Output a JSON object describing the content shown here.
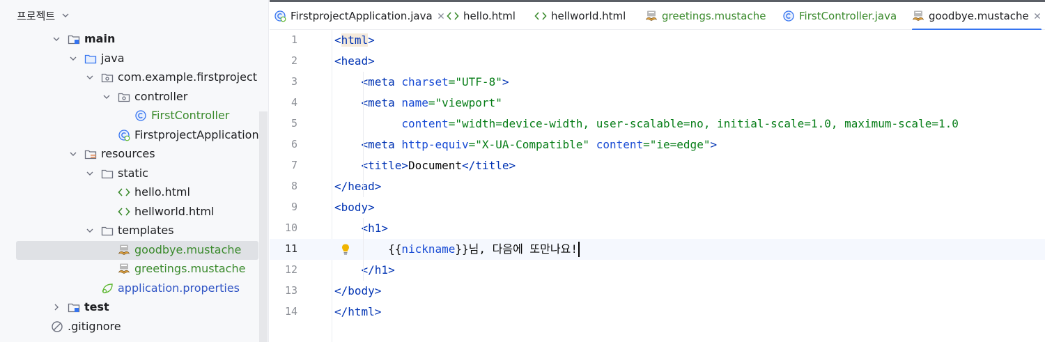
{
  "project_panel": {
    "title": "프로젝트",
    "tree": [
      {
        "name": "tree-row-main",
        "label": "main",
        "bold": true,
        "arrow": "expanded",
        "icon": "module-folder-icon",
        "color": "dark"
      },
      {
        "name": "tree-row-java",
        "label": "java",
        "bold": false,
        "arrow": "expanded",
        "icon": "source-folder-icon",
        "color": "dark"
      },
      {
        "name": "tree-row-package",
        "label": "com.example.firstproject",
        "bold": false,
        "arrow": "expanded",
        "icon": "package-icon",
        "color": "dark"
      },
      {
        "name": "tree-row-controller",
        "label": "controller",
        "bold": false,
        "arrow": "expanded",
        "icon": "package-icon",
        "color": "dark"
      },
      {
        "name": "tree-row-firstcontroller",
        "label": "FirstController",
        "bold": false,
        "arrow": "none",
        "icon": "java-class-icon",
        "color": "green"
      },
      {
        "name": "tree-row-firstprojectapplication",
        "label": "FirstprojectApplication",
        "bold": false,
        "arrow": "none",
        "icon": "spring-boot-class-icon",
        "color": "dark"
      },
      {
        "name": "tree-row-resources",
        "label": "resources",
        "bold": false,
        "arrow": "expanded",
        "icon": "resources-folder-icon",
        "color": "dark"
      },
      {
        "name": "tree-row-static",
        "label": "static",
        "bold": false,
        "arrow": "expanded",
        "icon": "folder-icon",
        "color": "dark"
      },
      {
        "name": "tree-row-hello-html",
        "label": "hello.html",
        "bold": false,
        "arrow": "none",
        "icon": "html-file-icon",
        "color": "dark"
      },
      {
        "name": "tree-row-hellworld-html",
        "label": "hellworld.html",
        "bold": false,
        "arrow": "none",
        "icon": "html-file-icon",
        "color": "dark"
      },
      {
        "name": "tree-row-templates",
        "label": "templates",
        "bold": false,
        "arrow": "expanded",
        "icon": "folder-icon",
        "color": "dark"
      },
      {
        "name": "tree-row-goodbye-mustache",
        "label": "goodbye.mustache",
        "bold": false,
        "arrow": "none",
        "icon": "mustache-file-icon",
        "color": "green",
        "selected": true
      },
      {
        "name": "tree-row-greetings-mustache",
        "label": "greetings.mustache",
        "bold": false,
        "arrow": "none",
        "icon": "mustache-file-icon",
        "color": "green"
      },
      {
        "name": "tree-row-application-properties",
        "label": "application.properties",
        "bold": false,
        "arrow": "none",
        "icon": "spring-properties-icon",
        "color": "blue"
      },
      {
        "name": "tree-row-test",
        "label": "test",
        "bold": true,
        "arrow": "collapsed",
        "icon": "module-folder-icon",
        "color": "dark"
      },
      {
        "name": "tree-row-gitignore",
        "label": ".gitignore",
        "bold": false,
        "arrow": "none",
        "icon": "ignore-file-icon",
        "color": "dark"
      }
    ]
  },
  "tabs": [
    {
      "name": "tab-firstprojectapplication",
      "label": "FirstprojectApplication.java",
      "icon": "spring-boot-class-icon",
      "color": "dark",
      "closable": true
    },
    {
      "name": "tab-hello-html",
      "label": "hello.html",
      "icon": "html-file-icon",
      "color": "dark"
    },
    {
      "name": "tab-hellworld-html",
      "label": "hellworld.html",
      "icon": "html-file-icon",
      "color": "dark"
    },
    {
      "name": "tab-greetings-mustache",
      "label": "greetings.mustache",
      "icon": "mustache-file-icon",
      "color": "green"
    },
    {
      "name": "tab-firstcontroller-java",
      "label": "FirstController.java",
      "icon": "java-class-icon",
      "color": "green"
    },
    {
      "name": "tab-goodbye-mustache",
      "label": "goodbye.mustache",
      "icon": "mustache-file-icon",
      "color": "dark",
      "closable": true,
      "active": true
    }
  ],
  "editor": {
    "current_line": 11,
    "lines": [
      {
        "n": "1",
        "tokens": [
          [
            "t",
            "<"
          ],
          [
            "th",
            "html"
          ],
          [
            "t",
            ">"
          ]
        ]
      },
      {
        "n": "2",
        "tokens": [
          [
            "t",
            "<head>"
          ]
        ]
      },
      {
        "n": "3",
        "tokens": [
          [
            "x",
            "    "
          ],
          [
            "t",
            "<meta "
          ],
          [
            "a",
            "charset"
          ],
          [
            "s",
            "=\"UTF-8\""
          ],
          [
            "t",
            ">"
          ]
        ]
      },
      {
        "n": "4",
        "tokens": [
          [
            "x",
            "    "
          ],
          [
            "t",
            "<meta "
          ],
          [
            "a",
            "name"
          ],
          [
            "s",
            "=\"viewport\""
          ]
        ]
      },
      {
        "n": "5",
        "tokens": [
          [
            "x",
            "          "
          ],
          [
            "a",
            "content"
          ],
          [
            "s",
            "=\"width=device-width, user-scalable=no, initial-scale=1.0, maximum-scale=1.0"
          ]
        ]
      },
      {
        "n": "6",
        "tokens": [
          [
            "x",
            "    "
          ],
          [
            "t",
            "<meta "
          ],
          [
            "a",
            "http-equiv"
          ],
          [
            "s",
            "=\"X-UA-Compatible\""
          ],
          [
            "x",
            " "
          ],
          [
            "a",
            "content"
          ],
          [
            "s",
            "=\"ie=edge\""
          ],
          [
            "t",
            ">"
          ]
        ]
      },
      {
        "n": "7",
        "tokens": [
          [
            "x",
            "    "
          ],
          [
            "t",
            "<title>"
          ],
          [
            "x",
            "Document"
          ],
          [
            "t",
            "</title>"
          ]
        ]
      },
      {
        "n": "8",
        "tokens": [
          [
            "t",
            "</head>"
          ]
        ]
      },
      {
        "n": "9",
        "tokens": [
          [
            "t",
            "<body>"
          ]
        ]
      },
      {
        "n": "10",
        "tokens": [
          [
            "x",
            "    "
          ],
          [
            "t",
            "<h1>"
          ]
        ]
      },
      {
        "n": "11",
        "tokens": [
          [
            "x",
            "        {{"
          ],
          [
            "a",
            "nickname"
          ],
          [
            "x",
            "}}님, 다음에 또만나요!"
          ]
        ]
      },
      {
        "n": "12",
        "tokens": [
          [
            "x",
            "    "
          ],
          [
            "t",
            "</h1>"
          ]
        ]
      },
      {
        "n": "13",
        "tokens": [
          [
            "t",
            "</body>"
          ]
        ]
      },
      {
        "n": "14",
        "tokens": [
          [
            "t",
            "</html>"
          ]
        ]
      }
    ]
  }
}
